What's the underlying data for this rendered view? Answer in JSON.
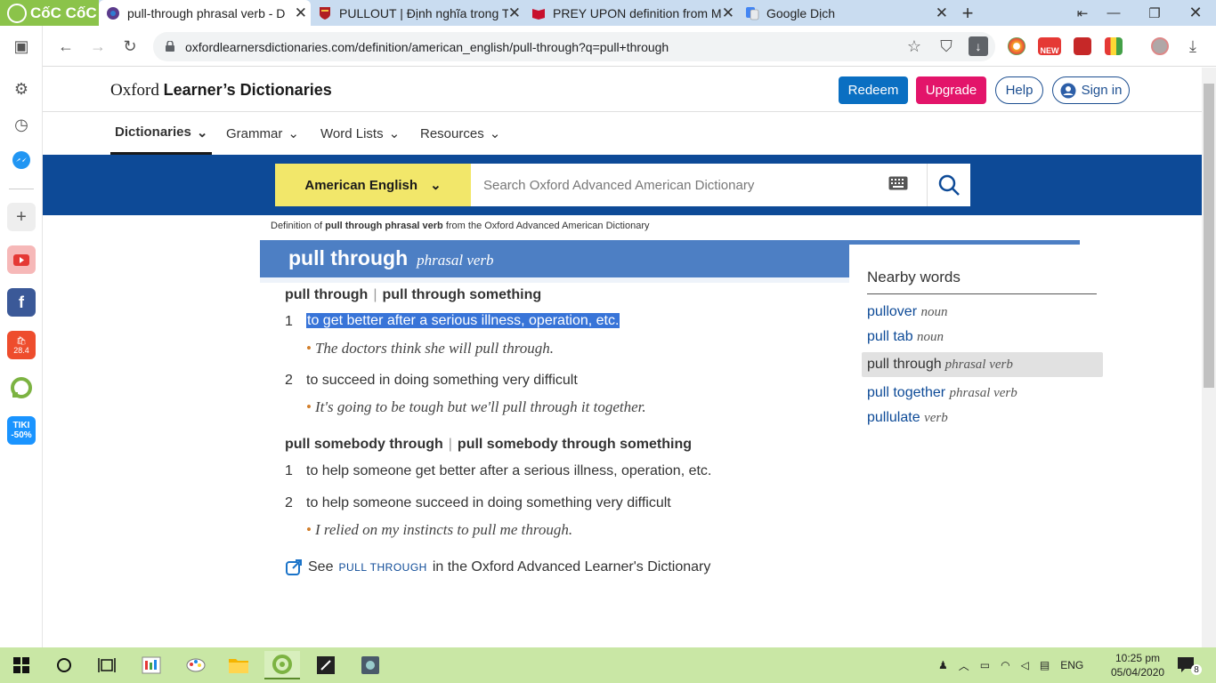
{
  "browser": {
    "brand": "CốC CốC",
    "tabs": [
      {
        "title": "pull-through phrasal verb - D",
        "active": true
      },
      {
        "title": "PULLOUT | Định nghĩa trong T",
        "active": false
      },
      {
        "title": "PREY UPON definition from M",
        "active": false
      },
      {
        "title": "Google Dịch",
        "active": false
      }
    ],
    "url": "oxfordlearnersdictionaries.com/definition/american_english/pull-through?q=pull+through",
    "ext_new_label": "NEW"
  },
  "sidebar": {
    "icons": [
      "sidebar-toggle-icon",
      "settings-icon",
      "history-icon",
      "messenger-icon",
      "add-icon",
      "youtube-icon",
      "facebook-icon",
      "shopee-icon",
      "coccoc-dict-icon",
      "tiki-icon"
    ],
    "shopee_badge": "28.4",
    "tiki_label": "TIKI",
    "tiki_discount": "-50%"
  },
  "site": {
    "logo_plain": "Oxford ",
    "logo_bold": "Learner’s Dictionaries",
    "buttons": {
      "redeem": "Redeem",
      "upgrade": "Upgrade",
      "help": "Help",
      "sign_in": "Sign in"
    },
    "nav": [
      "Dictionaries",
      "Grammar",
      "Word Lists",
      "Resources"
    ],
    "lang_select": "American English",
    "search_placeholder": "Search Oxford Advanced American Dictionary"
  },
  "entry": {
    "source_prefix": "Definition of ",
    "source_bold": "pull through phrasal verb",
    "source_suffix": " from the Oxford Advanced American Dictionary",
    "headword": "pull through",
    "pos": "phrasal verb",
    "groups": [
      {
        "forms": [
          "pull through",
          "pull through something"
        ],
        "senses": [
          {
            "num": "1",
            "def": "to get better after a serious illness, operation, etc.",
            "example": "The doctors think she will pull through.",
            "highlighted": true
          },
          {
            "num": "2",
            "def": "to succeed in doing something very difficult",
            "example": "It's going to be tough but we'll pull through it together."
          }
        ]
      },
      {
        "forms": [
          "pull somebody through",
          "pull somebody through something"
        ],
        "senses": [
          {
            "num": "1",
            "def": "to help someone get better after a serious illness, operation, etc.",
            "example": ""
          },
          {
            "num": "2",
            "def": "to help someone succeed in doing something very difficult",
            "example": "I relied on my instincts to pull me through."
          }
        ]
      }
    ],
    "see_also": {
      "prefix": "See ",
      "link": "PULL THROUGH",
      "suffix": " in the Oxford Advanced Learner's Dictionary"
    }
  },
  "nearby": {
    "title": "Nearby words",
    "items": [
      {
        "word": "pullover",
        "pos": "noun"
      },
      {
        "word": "pull tab",
        "pos": "noun"
      },
      {
        "word": "pull through",
        "pos": "phrasal verb",
        "current": true
      },
      {
        "word": "pull together",
        "pos": "phrasal verb"
      },
      {
        "word": "pullulate",
        "pos": "verb"
      }
    ]
  },
  "taskbar": {
    "lang": "ENG",
    "time": "10:25 pm",
    "date": "05/04/2020",
    "notifications": "8"
  },
  "colors": {
    "accent_blue": "#0d4a97",
    "redeem": "#0a6fc2",
    "upgrade": "#e3146a",
    "lang_yellow": "#f2e76a",
    "highlight": "#3874d8",
    "taskbar": "#c9e7a5"
  }
}
